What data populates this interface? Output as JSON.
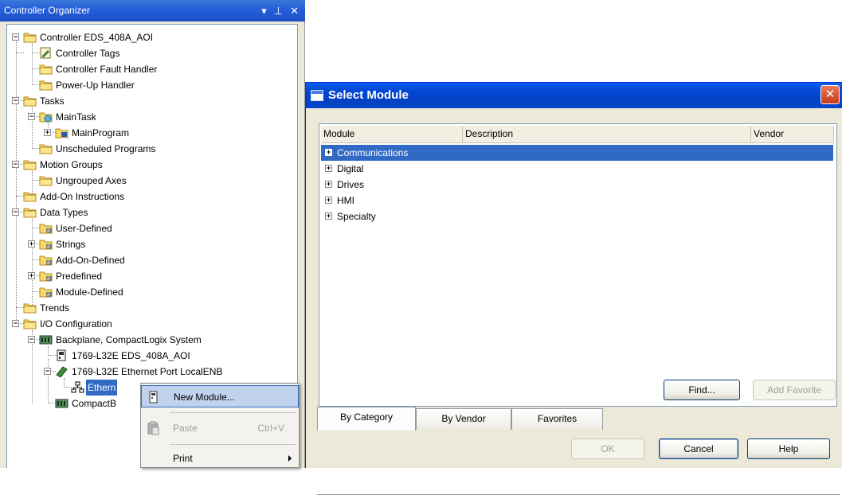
{
  "organizer": {
    "title": "Controller Organizer",
    "pin_glyph": "↓",
    "pushpin_glyph": "1",
    "close_glyph": "✕",
    "tree": [
      {
        "label": "Controller EDS_408A_AOI",
        "icon": "folder-icon",
        "expander": "-"
      },
      {
        "label": "Controller Tags",
        "icon": "tags-icon"
      },
      {
        "label": "Controller Fault Handler",
        "icon": "folder-icon"
      },
      {
        "label": "Power-Up Handler",
        "icon": "folder-icon"
      },
      {
        "label": "Tasks",
        "icon": "folder-icon",
        "expander": "-"
      },
      {
        "label": "MainTask",
        "icon": "task-icon",
        "expander": "-"
      },
      {
        "label": "MainProgram",
        "icon": "program-icon",
        "expander": "+"
      },
      {
        "label": "Unscheduled Programs",
        "icon": "folder-icon"
      },
      {
        "label": "Motion Groups",
        "icon": "folder-icon",
        "expander": "-"
      },
      {
        "label": "Ungrouped Axes",
        "icon": "folder-icon"
      },
      {
        "label": "Add-On Instructions",
        "icon": "folder-icon"
      },
      {
        "label": "Data Types",
        "icon": "folder-icon",
        "expander": "-"
      },
      {
        "label": "User-Defined",
        "icon": "datatype-icon"
      },
      {
        "label": "Strings",
        "icon": "datatype-icon",
        "expander": "+"
      },
      {
        "label": "Add-On-Defined",
        "icon": "datatype-icon"
      },
      {
        "label": "Predefined",
        "icon": "datatype-icon",
        "expander": "+"
      },
      {
        "label": "Module-Defined",
        "icon": "datatype-icon"
      },
      {
        "label": "Trends",
        "icon": "folder-icon"
      },
      {
        "label": "I/O Configuration",
        "icon": "folder-icon",
        "expander": "-"
      },
      {
        "label": "Backplane, CompactLogix System",
        "icon": "backplane-icon",
        "expander": "-"
      },
      {
        "label": "1769-L32E EDS_408A_AOI",
        "icon": "controller-icon"
      },
      {
        "label": "1769-L32E Ethernet Port LocalENB",
        "icon": "ethernet-port-icon",
        "expander": "-"
      },
      {
        "label": "Ethern",
        "icon": "network-icon"
      },
      {
        "label": "CompactB",
        "icon": "backplane-icon"
      }
    ]
  },
  "context_menu": {
    "items": [
      {
        "label": "New Module...",
        "shortcut": "",
        "icon": "new-module-icon",
        "highlighted": true,
        "disabled": false
      },
      {
        "label": "Paste",
        "shortcut": "Ctrl+V",
        "icon": "paste-icon",
        "highlighted": false,
        "disabled": true
      },
      {
        "label": "Print",
        "shortcut": "",
        "icon": "",
        "highlighted": false,
        "disabled": false,
        "submenu": true
      }
    ]
  },
  "dialog": {
    "title": "Select Module",
    "close_glyph": "✕",
    "columns": [
      "Module",
      "Description",
      "Vendor"
    ],
    "rows": [
      {
        "label": "Communications",
        "selected": true
      },
      {
        "label": "Digital",
        "selected": false
      },
      {
        "label": "Drives",
        "selected": false
      },
      {
        "label": "HMI",
        "selected": false
      },
      {
        "label": "Specialty",
        "selected": false
      }
    ],
    "expander_glyph": "+",
    "find_label": "Find...",
    "add_favorite_label": "Add Favorite",
    "tabs": [
      {
        "label": "By Category",
        "active": true
      },
      {
        "label": "By Vendor",
        "active": false
      },
      {
        "label": "Favorites",
        "active": false
      }
    ],
    "ok_label": "OK",
    "cancel_label": "Cancel",
    "help_label": "Help"
  }
}
